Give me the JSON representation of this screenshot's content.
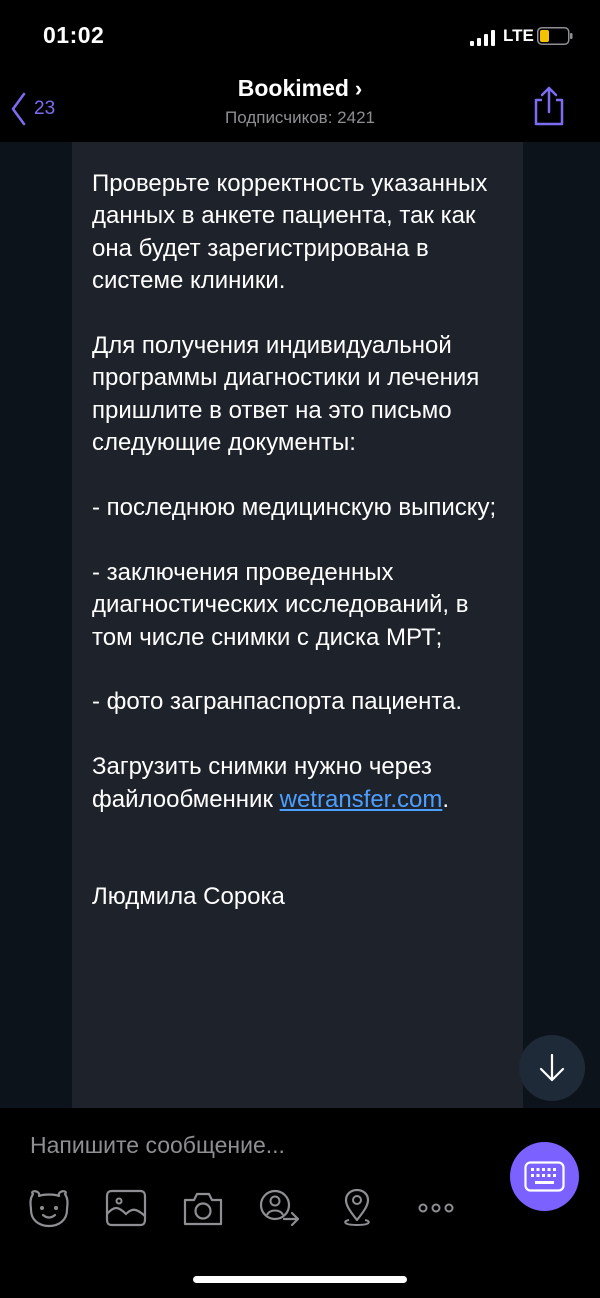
{
  "status_bar": {
    "time": "01:02",
    "network": "LTE"
  },
  "header": {
    "back_count": "23",
    "title": "Bookimed",
    "title_chevron": "›",
    "subtitle": "Подписчиков: 2421"
  },
  "message": {
    "paragraphs": [
      "Проверьте корректность указанных данных в анкете пациента, так как она будет зарегистрирована в системе клиники.",
      "Для получения индивидуальной программы диагностики и лечения пришлите в ответ на это письмо следующие документы:",
      "- последнюю медицинскую выписку;",
      "- заключения проведенных диагностических исследований, в том числе снимки с диска МРТ;",
      "- фото загранпаспорта пациента."
    ],
    "upload_text": "Загрузить снимки нужно через файлообменник ",
    "upload_link": "wetransfer.com",
    "upload_end": ".",
    "signature": "Людмила Сорока"
  },
  "composer": {
    "placeholder": "Напишите сообщение...",
    "tools": [
      "sticker-icon",
      "gif-icon",
      "camera-icon",
      "share-contact-icon",
      "location-icon",
      "more-icon"
    ]
  },
  "colors": {
    "accent": "#7b61ff",
    "link": "#4d9fff",
    "bubble": "#1e222a",
    "chat_bg": "#0c131a"
  }
}
